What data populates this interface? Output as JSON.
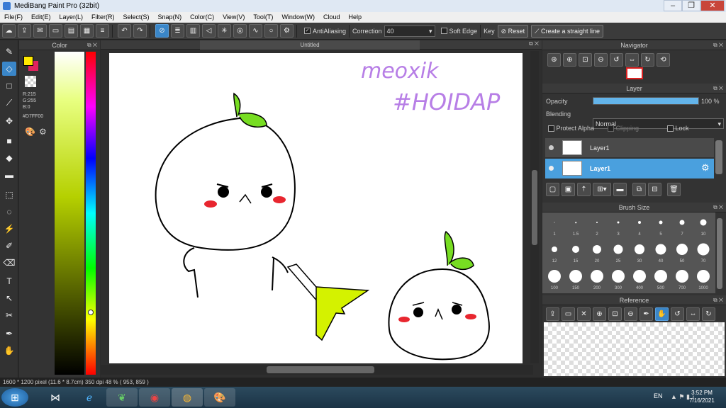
{
  "window": {
    "title": "MediBang Paint Pro (32bit)",
    "min_icon": "minimize-icon",
    "max_icon": "maximize-icon",
    "close_icon": "close-icon"
  },
  "menu": [
    "File(F)",
    "Edit(E)",
    "Layer(L)",
    "Filter(R)",
    "Select(S)",
    "Snap(N)",
    "Color(C)",
    "View(V)",
    "Tool(T)",
    "Window(W)",
    "Cloud",
    "Help"
  ],
  "toolbar": {
    "antialiasing_label": "AntiAliasing",
    "correction_label": "Correction",
    "correction_value": "40",
    "soft_edge_label": "Soft Edge",
    "key_label": "Key",
    "reset_label": "Reset",
    "straight_line_label": "Create a straight line"
  },
  "color_panel": {
    "title": "Color",
    "r": "R:215",
    "g": "G:255",
    "b": "B:0",
    "hex": "#D7FF00",
    "fg": "#D7FF00",
    "accent": "#e0245e"
  },
  "document": {
    "tab_title": "Untitled",
    "handwriting_line1": "meoxik",
    "handwriting_line2": "#HOIDAP"
  },
  "navigator": {
    "title": "Navigator"
  },
  "layer_panel": {
    "title": "Layer",
    "opacity_label": "Opacity",
    "opacity_value": "100 %",
    "opacity_fraction": 1.0,
    "blending_label": "Blending",
    "blending_value": "Normal",
    "protect_alpha_label": "Protect Alpha",
    "clipping_label": "Clipping",
    "lock_label": "Lock",
    "layers": [
      {
        "name": "Layer1",
        "selected": false
      },
      {
        "name": "Layer1",
        "selected": true
      }
    ]
  },
  "brush_size": {
    "title": "Brush Size",
    "sizes": [
      "1",
      "1.5",
      "2",
      "3",
      "4",
      "5",
      "7",
      "10",
      "12",
      "15",
      "20",
      "25",
      "30",
      "40",
      "50",
      "70",
      "100",
      "150",
      "200",
      "300",
      "400",
      "500",
      "700",
      "1000"
    ]
  },
  "reference": {
    "title": "Reference"
  },
  "status": {
    "text": "1600 * 1200 pixel  (11.6 * 8.7cm)  350 dpi  48 %  ( 953, 859 )"
  },
  "taskbar": {
    "lang": "EN",
    "time": "3:52 PM",
    "date": "7/16/2021"
  }
}
